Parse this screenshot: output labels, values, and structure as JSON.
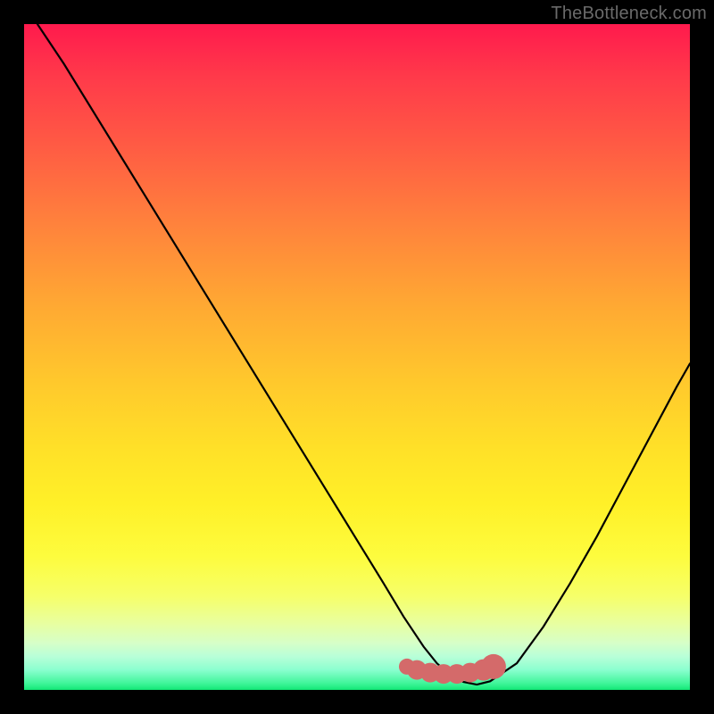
{
  "watermark": {
    "text": "TheBottleneck.com"
  },
  "colors": {
    "frame": "#000000",
    "curve": "#000000",
    "datapoints_fill": "#d46a6a",
    "datapoints_stroke": "#c65555"
  },
  "chart_data": {
    "type": "line",
    "title": "",
    "xlabel": "",
    "ylabel": "",
    "xlim": [
      0,
      100
    ],
    "ylim": [
      0,
      100
    ],
    "grid": false,
    "series": [
      {
        "name": "bottleneck-curve",
        "x": [
          2,
          6,
          10,
          14,
          18,
          22,
          26,
          30,
          34,
          38,
          42,
          46,
          50,
          54,
          57,
          60,
          62,
          64,
          66,
          68,
          70,
          74,
          78,
          82,
          86,
          90,
          94,
          98,
          100
        ],
        "y": [
          100,
          94,
          87.5,
          81,
          74.5,
          68,
          61.5,
          55,
          48.5,
          42,
          35.5,
          29,
          22.5,
          16,
          11,
          6.5,
          4,
          2.2,
          1.2,
          0.8,
          1.3,
          4,
          9.5,
          16,
          23,
          30.5,
          38,
          45.5,
          49
        ]
      }
    ],
    "datapoints": {
      "name": "highlighted-range",
      "x": [
        57.5,
        59,
        61,
        63,
        65,
        67,
        69,
        70.5
      ],
      "y": [
        3.5,
        3.0,
        2.6,
        2.4,
        2.4,
        2.6,
        3.0,
        3.5
      ],
      "marker_size": [
        9,
        11,
        11,
        11,
        11,
        11,
        12,
        14
      ]
    }
  }
}
